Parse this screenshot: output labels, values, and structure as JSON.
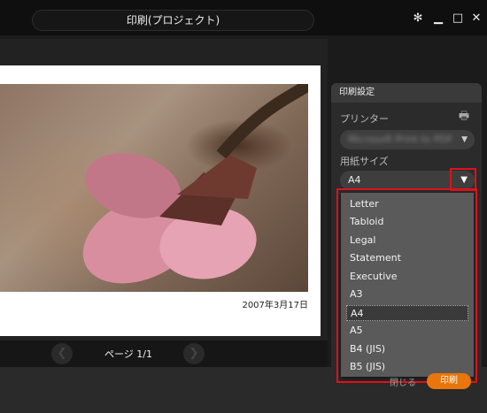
{
  "window": {
    "title": "印刷(プロジェクト)"
  },
  "preview": {
    "photo_date": "2007年3月17日",
    "page_label": "ページ 1/1"
  },
  "panel": {
    "header": "印刷設定",
    "printer_label": "プリンター",
    "printer_value": "Microsoft Print to PDF",
    "paper_size_label": "用紙サイズ",
    "paper_size_value": "A4"
  },
  "dropdown": {
    "options": [
      "Letter",
      "Tabloid",
      "Legal",
      "Statement",
      "Executive",
      "A3",
      "A4",
      "A5",
      "B4 (JIS)",
      "B5 (JIS)"
    ],
    "selected": "A4"
  },
  "footer": {
    "print_label": "印刷",
    "cancel_label": "閉じる"
  },
  "colors": {
    "accent": "#e8760a",
    "highlight": "#e0101a"
  }
}
